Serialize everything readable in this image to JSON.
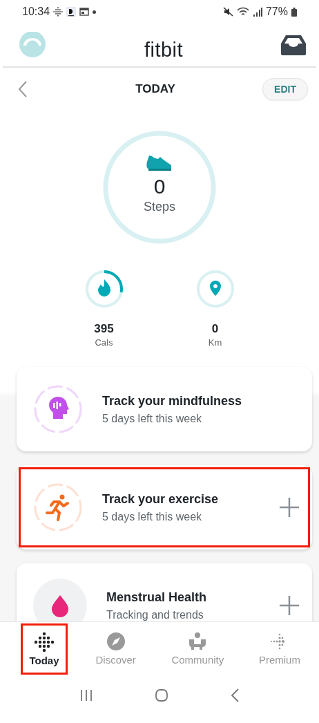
{
  "status_bar": {
    "time": "10:34",
    "battery": "77%"
  },
  "header": {
    "logo": "fitbit"
  },
  "date_bar": {
    "title": "TODAY",
    "edit": "EDIT"
  },
  "steps": {
    "value": "0",
    "label": "Steps"
  },
  "stats": [
    {
      "kind": "calories",
      "value": "395",
      "unit": "Cals"
    },
    {
      "kind": "distance",
      "value": "0",
      "unit": "Km"
    }
  ],
  "cards": [
    {
      "kind": "mindfulness",
      "title": "Track your mindfulness",
      "subtitle": "5 days left this week",
      "add_button": false,
      "highlighted": false
    },
    {
      "kind": "exercise",
      "title": "Track your exercise",
      "subtitle": "5 days left this week",
      "add_button": true,
      "highlighted": true
    },
    {
      "kind": "menstrual",
      "title": "Menstrual Health",
      "subtitle": "Tracking and trends",
      "add_button": true,
      "highlighted": false
    }
  ],
  "tabs": [
    {
      "kind": "today",
      "label": "Today",
      "selected": true,
      "highlighted": true
    },
    {
      "kind": "discover",
      "label": "Discover",
      "selected": false,
      "highlighted": false
    },
    {
      "kind": "community",
      "label": "Community",
      "selected": false,
      "highlighted": false
    },
    {
      "kind": "premium",
      "label": "Premium",
      "selected": false,
      "highlighted": false
    }
  ]
}
